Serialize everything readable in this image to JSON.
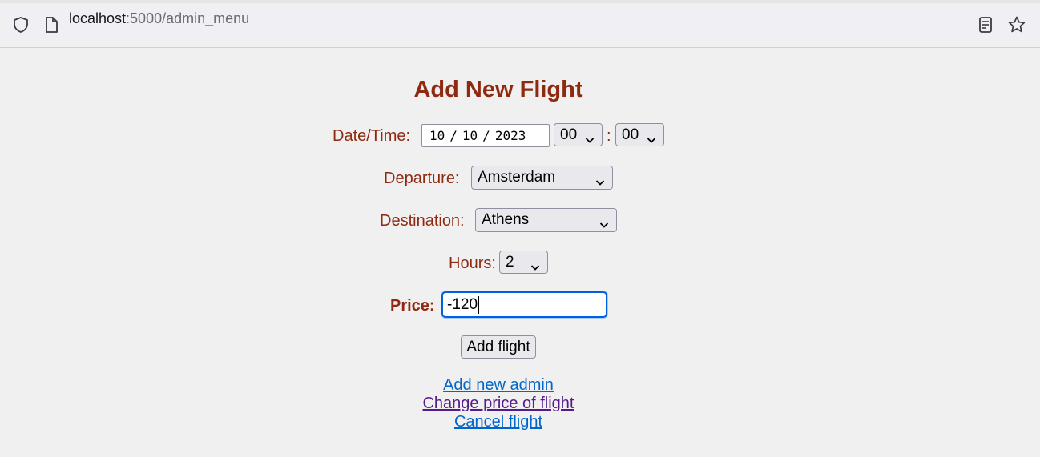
{
  "browser": {
    "url_host": "localhost",
    "url_path": ":5000/admin_menu",
    "icons": [
      "shield-icon",
      "page-icon",
      "reader-view-icon",
      "bookmark-star-icon"
    ]
  },
  "page": {
    "title": "Add New Flight"
  },
  "form": {
    "datetime": {
      "label": "Date/Time:",
      "month": "10",
      "day": "10",
      "year": "2023",
      "date_sep": "/",
      "hour": "00",
      "time_sep": ":",
      "minute": "00"
    },
    "departure": {
      "label": "Departure:",
      "value": "Amsterdam"
    },
    "destination": {
      "label": "Destination:",
      "value": "Athens"
    },
    "hours": {
      "label": "Hours:",
      "value": "2"
    },
    "price": {
      "label": "Price:",
      "value": "-120"
    },
    "submit_label": "Add flight"
  },
  "links": {
    "add_admin": "Add new admin",
    "change_price": "Change price of flight",
    "cancel_flight": "Cancel flight"
  },
  "colors": {
    "label": "#8f2a11",
    "link": "#0066cc",
    "link_visited": "#551a8b",
    "focus": "#0061e0"
  }
}
